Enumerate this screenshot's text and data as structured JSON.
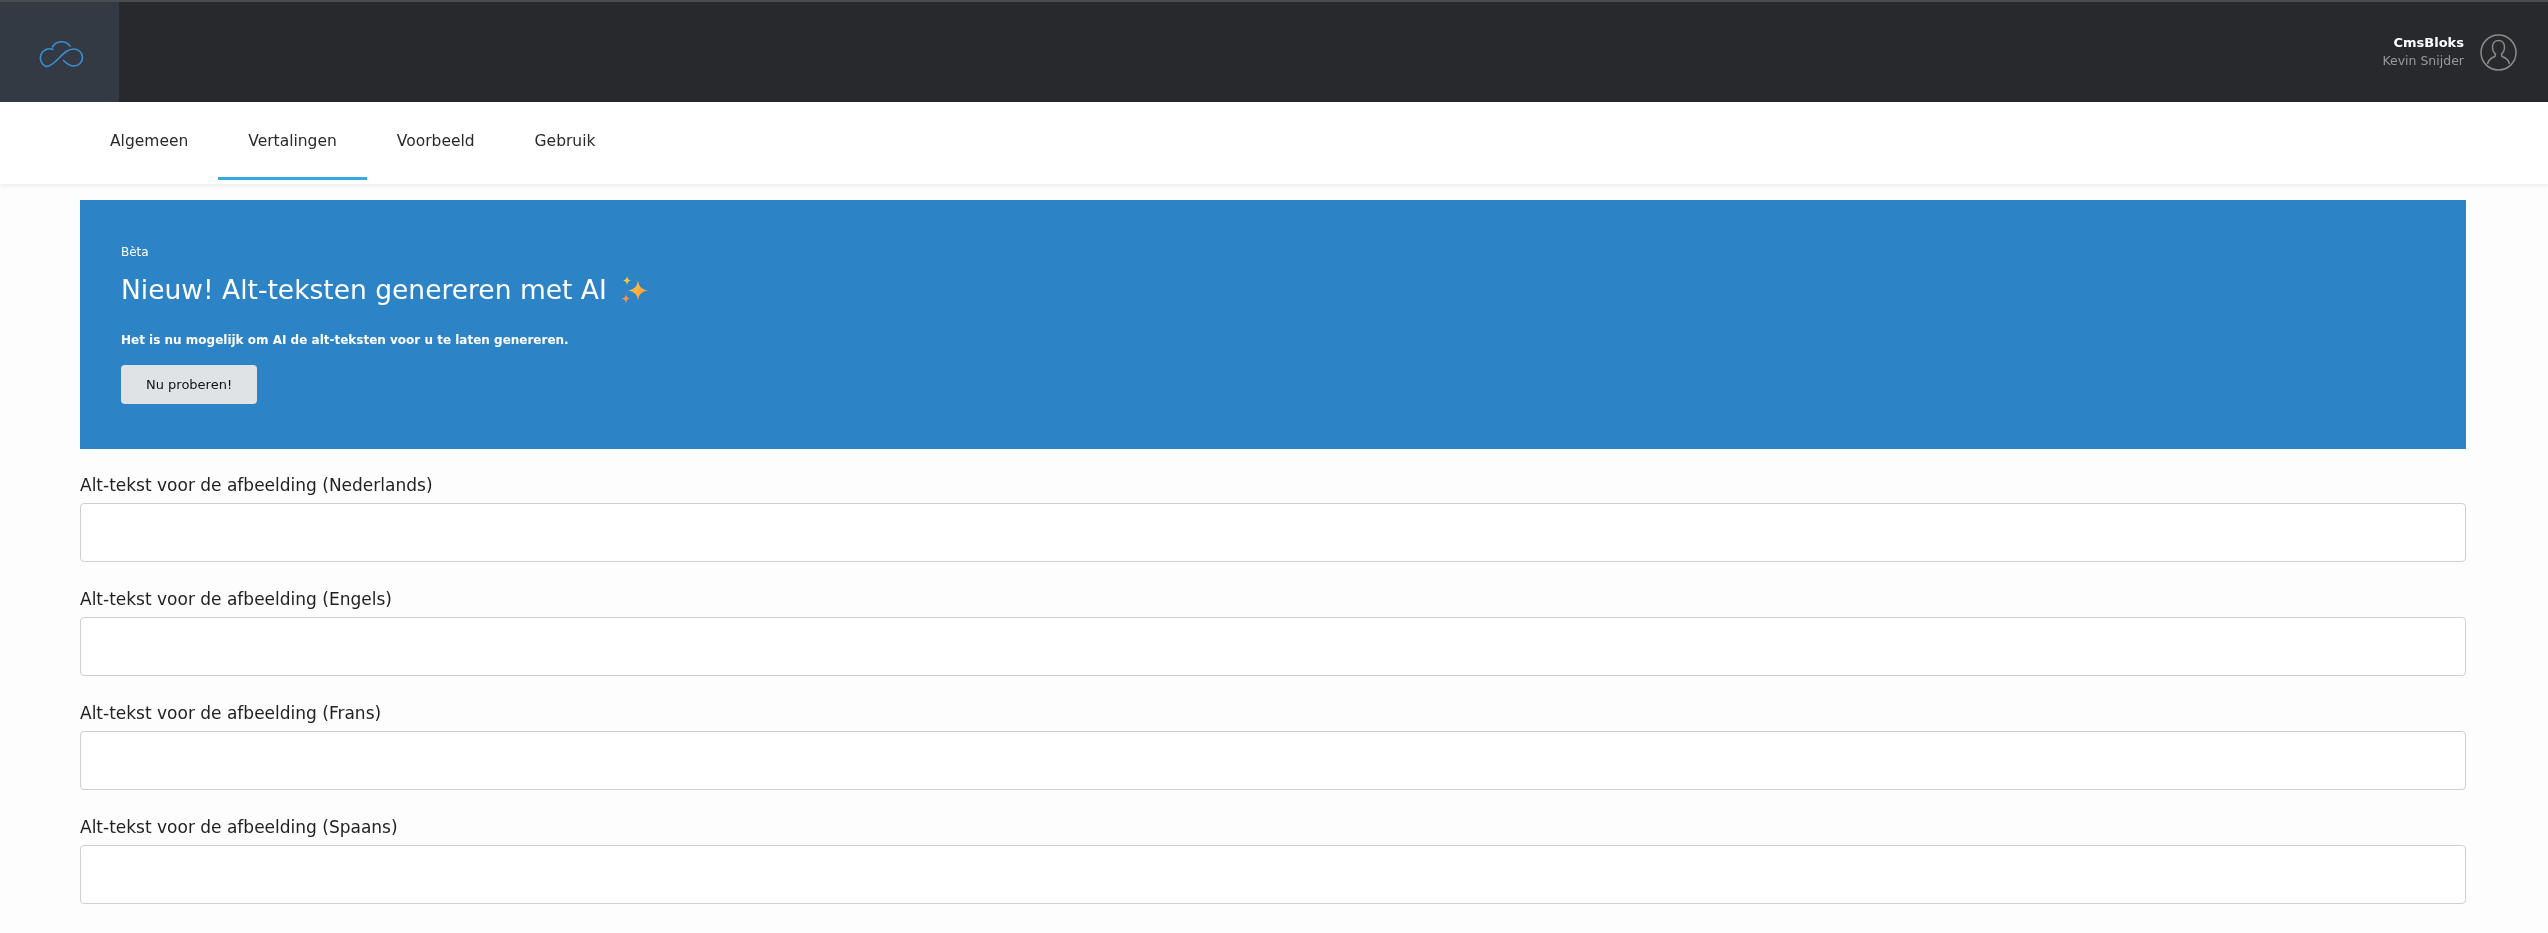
{
  "header": {
    "account": {
      "organization": "CmsBloks",
      "user": "Kevin Snijder"
    }
  },
  "tabs": [
    {
      "label": "Algemeen",
      "selected": false
    },
    {
      "label": "Vertalingen",
      "selected": true
    },
    {
      "label": "Voorbeeld",
      "selected": false
    },
    {
      "label": "Gebruik",
      "selected": false
    }
  ],
  "banner": {
    "badge": "Bèta",
    "title": "Nieuw! Alt-teksten genereren met AI",
    "description": "Het is nu mogelijk om AI de alt-teksten voor u te laten genereren.",
    "button": "Nu proberen!"
  },
  "fields": [
    {
      "label": "Alt-tekst voor de afbeelding (Nederlands)"
    },
    {
      "label": "Alt-tekst voor de afbeelding (Engels)"
    },
    {
      "label": "Alt-tekst voor de afbeelding (Frans)"
    },
    {
      "label": "Alt-tekst voor de afbeelding (Spaans)"
    }
  ]
}
